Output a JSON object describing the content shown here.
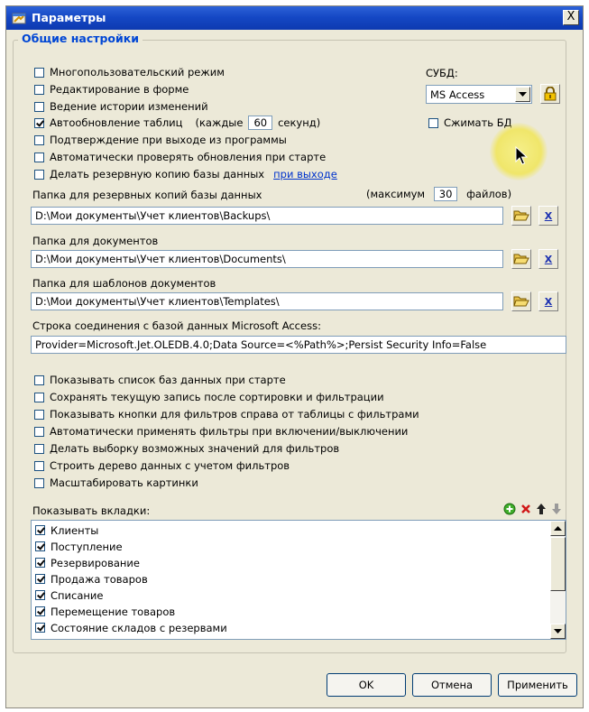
{
  "window": {
    "title": "Параметры",
    "close_label": "X"
  },
  "general": {
    "group_title": "Общие настройки",
    "checkboxes": [
      {
        "label": "Многопользовательский режим",
        "checked": false
      },
      {
        "label": "Редактирование в форме",
        "checked": false
      },
      {
        "label": "Ведение истории изменений",
        "checked": false
      },
      {
        "label": "Автообновление таблиц",
        "checked": true
      },
      {
        "label": "Подтверждение при выходе из программы",
        "checked": false
      },
      {
        "label": "Автоматически проверять обновления при старте",
        "checked": false
      },
      {
        "label": "Делать резервную копию базы данных",
        "checked": false
      }
    ],
    "autoupdate_prefix": "(каждые",
    "autoupdate_value": "60",
    "autoupdate_suffix": "секунд)",
    "backup_link": "при выходе",
    "dbms_label": "СУБД:",
    "dbms_value": "MS Access",
    "compress_label": "Сжимать БД",
    "compress_checked": false
  },
  "folders": {
    "backup_label": "Папка для резервных копий базы данных",
    "max_prefix": "(максимум",
    "max_value": "30",
    "max_suffix": "файлов)",
    "backup_path": "D:\\Мои документы\\Учет клиентов\\Backups\\",
    "docs_label": "Папка для документов",
    "docs_path": "D:\\Мои документы\\Учет клиентов\\Documents\\",
    "templates_label": "Папка для шаблонов документов",
    "templates_path": "D:\\Мои документы\\Учет клиентов\\Templates\\",
    "conn_label": "Строка соединения с базой данных Microsoft Access:",
    "conn_value": "Provider=Microsoft.Jet.OLEDB.4.0;Data Source=<%Path%>;Persist Security Info=False",
    "clear_label": "X"
  },
  "options": [
    {
      "label": "Показывать список баз данных при старте",
      "checked": false
    },
    {
      "label": "Сохранять текущую запись после сортировки и фильтрации",
      "checked": false
    },
    {
      "label": "Показывать кнопки для фильтров справа от таблицы с фильтрами",
      "checked": false
    },
    {
      "label": "Автоматически применять фильтры при включении/выключении",
      "checked": false
    },
    {
      "label": "Делать выборку возможных значений для фильтров",
      "checked": false
    },
    {
      "label": "Строить дерево данных с учетом фильтров",
      "checked": false
    },
    {
      "label": "Масштабировать картинки",
      "checked": false
    }
  ],
  "tabs_section": {
    "label": "Показывать вкладки:",
    "items": [
      {
        "label": "Клиенты",
        "checked": true
      },
      {
        "label": "Поступление",
        "checked": true
      },
      {
        "label": "Резервирование",
        "checked": true
      },
      {
        "label": "Продажа товаров",
        "checked": true
      },
      {
        "label": "Списание",
        "checked": true
      },
      {
        "label": "Перемещение товаров",
        "checked": true
      },
      {
        "label": "Состояние складов с резервами",
        "checked": true
      }
    ]
  },
  "buttons": {
    "ok": "OK",
    "cancel": "Отмена",
    "apply": "Применить"
  },
  "colors": {
    "title_bar": "#1548c5",
    "dialog_bg": "#ece9d8",
    "group_title": "#0046d5",
    "link": "#0033cc"
  }
}
